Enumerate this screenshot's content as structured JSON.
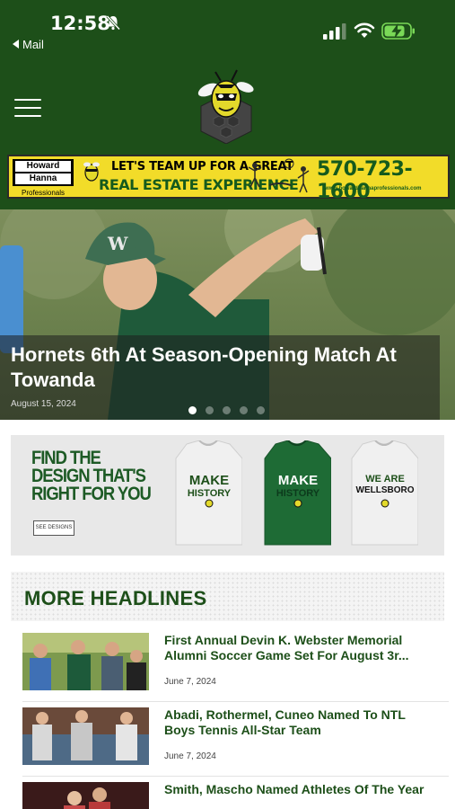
{
  "status_bar": {
    "time": "12:58",
    "back_label": "Mail"
  },
  "header": {
    "logo_icon": "hornet-mascot-logo",
    "menu_icon": "hamburger-menu-icon",
    "brand_color": "#1d4f19"
  },
  "sponsor": {
    "logo_line1": "Howard",
    "logo_line2": "Hanna",
    "logo_sub": "Professionals",
    "line1": "LET'S TEAM UP FOR A GREAT",
    "line2": "REAL ESTATE EXPERIENCE",
    "phone": "570-723-1600",
    "url": "www.howardhannaprofessionals.com",
    "bg_color": "#f2dc29"
  },
  "hero": {
    "title": "Hornets 6th At Season-Opening Match At Towanda",
    "date": "August 15, 2024",
    "slide_count": 5,
    "active_slide": 1
  },
  "shirt_ad": {
    "headline_line1": "FIND THE",
    "headline_line2": "DESIGN THAT'S",
    "headline_line3": "RIGHT FOR YOU",
    "button_label": "SEE DESIGNS",
    "shirts": [
      {
        "line1": "MAKE",
        "line2": "HISTORY",
        "color": "#f0f0f0"
      },
      {
        "line1": "MAKE",
        "line2": "HISTORY",
        "color": "#1e6b35"
      },
      {
        "line1": "WE ARE",
        "line2": "WELLSBORO",
        "color": "#f0f0f0"
      }
    ]
  },
  "more_headlines": {
    "title": "MORE HEADLINES",
    "items": [
      {
        "title": "First Annual Devin K. Webster Memorial Alumni Soccer Game Set For August 3r...",
        "date": "June 7, 2024"
      },
      {
        "title": "Abadi, Rothermel, Cuneo Named To NTL Boys Tennis All-Star Team",
        "date": "June 7, 2024"
      },
      {
        "title": "Smith, Mascho Named Athletes Of The Year",
        "date": ""
      }
    ]
  }
}
